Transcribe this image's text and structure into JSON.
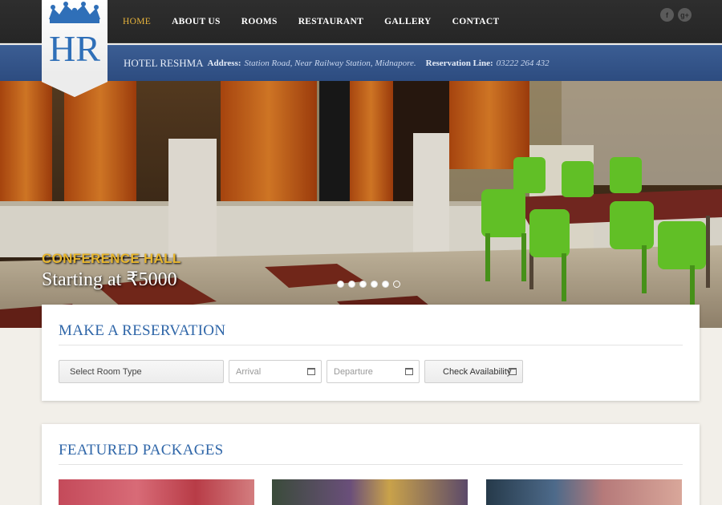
{
  "nav": {
    "items": [
      {
        "label": "HOME",
        "active": true
      },
      {
        "label": "ABOUT US",
        "active": false
      },
      {
        "label": "ROOMS",
        "active": false
      },
      {
        "label": "RESTAURANT",
        "active": false
      },
      {
        "label": "GALLERY",
        "active": false
      },
      {
        "label": "CONTACT",
        "active": false
      }
    ],
    "social": [
      {
        "icon": "facebook-icon",
        "glyph": "f"
      },
      {
        "icon": "google-plus-icon",
        "glyph": "g+"
      }
    ]
  },
  "logo": {
    "text": "HR",
    "icon": "crown-icon"
  },
  "info": {
    "hotel_name": "HOTEL RESHMA",
    "address_label": "Address:",
    "address_value": "Station Road, Near Railway Station, Midnapore.",
    "reservation_label": "Reservation Line:",
    "reservation_value": "03222 264 432"
  },
  "hero": {
    "title": "CONFERENCE HALL",
    "subtitle": "Starting at ₹5000",
    "slide_count": 6,
    "current_slide": 6
  },
  "reservation": {
    "heading": "MAKE A RESERVATION",
    "room_type": "Select Room Type",
    "arrival_placeholder": "Arrival",
    "departure_placeholder": "Departure",
    "check_label": "Check Availability"
  },
  "featured": {
    "heading": "FEATURED PACKAGES"
  },
  "colors": {
    "accent": "#2f66a8",
    "active_nav": "#e8b43c",
    "hero_title": "#e7b62f",
    "infobar": "#345487"
  }
}
